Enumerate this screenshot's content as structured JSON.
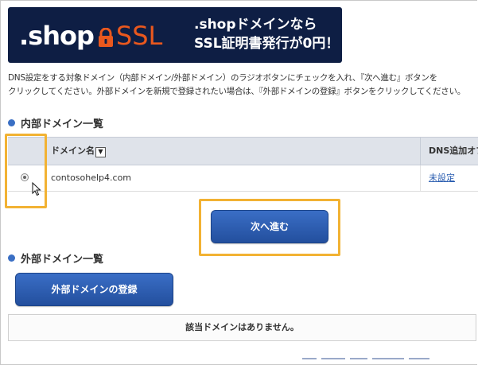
{
  "banner": {
    "logo_text": ".shop",
    "logo_ssl": "SSL",
    "promo_line1": ".shopドメインなら",
    "promo_line2": "SSL証明書発行が0円！",
    "colors": {
      "background": "#0e1e44",
      "accent": "#e9581e"
    }
  },
  "description": {
    "line1": "DNS設定をする対象ドメイン（内部ドメイン/外部ドメイン）のラジオボタンにチェックを入れ、『次へ進む』ボタンを",
    "line2": "クリックしてください。外部ドメインを新規で登録されたい場合は、『外部ドメインの登録』ボタンをクリックしてください。"
  },
  "internal_section": {
    "title": "内部ドメイン一覧",
    "table": {
      "headers": {
        "name": "ドメイン名",
        "dns": "DNS追加オプ"
      },
      "rows": [
        {
          "selected": true,
          "domain": "contosohelp4.com",
          "dns_status": "未設定"
        }
      ]
    },
    "next_button": "次へ進む"
  },
  "external_section": {
    "title": "外部ドメイン一覧",
    "register_button": "外部ドメインの登録",
    "empty_message": "該当ドメインはありません。"
  },
  "highlight_color": "#f2b233",
  "accent_color": "#3a6fc4"
}
